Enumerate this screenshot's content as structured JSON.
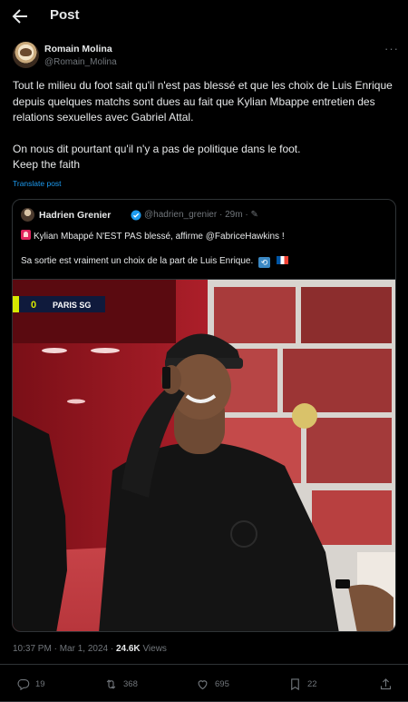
{
  "header": {
    "title": "Post"
  },
  "tweet": {
    "author_name": "Romain Molina",
    "author_handle": "@Romain_Molina",
    "text_p1": "Tout le milieu du foot sait qu'il n'est pas blessé et que les choix de Luis Enrique depuis quelques matchs sont dues au fait que Kylian Mbappe entretien des relations sexuelles avec Gabriel Attal.",
    "text_p2": "On nous dit pourtant qu'il n'y a pas de politique dans le foot.",
    "text_p3": "Keep the faith",
    "translate_label": "Translate post",
    "time": "10:37 PM",
    "date": "Mar 1, 2024",
    "views_count": "24.6K",
    "views_label": "Views"
  },
  "quote": {
    "author_name": "Hadrien Grenier",
    "author_handle": "@hadrien_grenier · 29m ·",
    "line1": "Kylian Mbappé N'EST PAS blessé, affirme @FabriceHawkins !",
    "line2": "Sa sortie est vraiment un choix de la part de Luis Enrique.",
    "media": {
      "score": "0",
      "team": "PARIS SG"
    }
  },
  "actions": {
    "replies": "19",
    "reposts": "368",
    "likes": "695",
    "bookmarks": "22"
  },
  "colors": {
    "background": "#000000",
    "text": "#e7e9ea",
    "muted": "#71767b",
    "accent": "#1d9bf0",
    "border": "#2f3336"
  }
}
